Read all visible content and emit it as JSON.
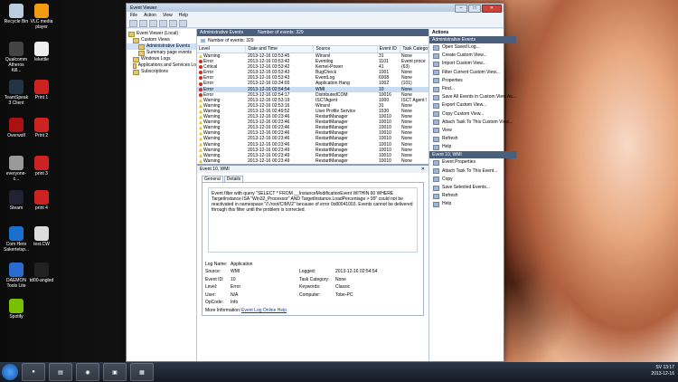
{
  "desktop": {
    "icons": [
      {
        "label": "Recycle Bin",
        "color": "#bcd"
      },
      {
        "label": "VLC media player",
        "color": "#f39c12"
      },
      {
        "label": "Qualcomm Atheros Kill...",
        "color": "#444"
      },
      {
        "label": "lekettle",
        "color": "#eee"
      },
      {
        "label": "TeamSpeak 3 Client",
        "color": "#234"
      },
      {
        "label": "Print 1",
        "color": "#c22"
      },
      {
        "label": "Overwolf",
        "color": "#a11"
      },
      {
        "label": "Print 2",
        "color": "#c22"
      },
      {
        "label": "everyone-c...",
        "color": "#999"
      },
      {
        "label": "print 3",
        "color": "#c22"
      },
      {
        "label": "Steam",
        "color": "#223"
      },
      {
        "label": "print 4",
        "color": "#c22"
      },
      {
        "label": "Com Here Sakertetsp...",
        "color": "#1b6fd1"
      },
      {
        "label": "test.CW",
        "color": "#ddd"
      },
      {
        "label": "DAEMON Tools Lite",
        "color": "#2a6bd0"
      },
      {
        "label": "td00-angled",
        "color": "#222"
      },
      {
        "label": "Spotify",
        "color": "#79c000"
      }
    ]
  },
  "window": {
    "title": "Event Viewer",
    "menu": [
      "File",
      "Action",
      "View",
      "Help"
    ],
    "tree": [
      "Event Viewer (Local)",
      "Custom Views",
      "Administrative Events",
      "Summary page events",
      "Windows Logs",
      "Applications and Services Lo",
      "Subscriptions"
    ]
  },
  "center": {
    "header": "Administrative Events",
    "header_count": "Number of events: 329",
    "count_label": "Number of events: 329",
    "columns": [
      "Level",
      "Date and Time",
      "Source",
      "Event ID",
      "Task Catego"
    ],
    "rows": [
      {
        "level": "Warning",
        "icon": "warning",
        "date": "2013-12-16 03:53:45",
        "source": "Winsrvl",
        "id": "31",
        "task": "None"
      },
      {
        "level": "Error",
        "icon": "error",
        "date": "2013-12-16 03:53:42",
        "source": "Eventlog",
        "id": "1101",
        "task": "Event proce"
      },
      {
        "level": "Critical",
        "icon": "critical",
        "date": "2013-12-16 03:53:42",
        "source": "Kernel-Power",
        "id": "41",
        "task": "(63)"
      },
      {
        "level": "Error",
        "icon": "error",
        "date": "2013-12-16 03:53:43",
        "source": "BugCheck",
        "id": "1001",
        "task": "None"
      },
      {
        "level": "Error",
        "icon": "error",
        "date": "2013-12-16 03:53:43",
        "source": "EventLog",
        "id": "6008",
        "task": "None"
      },
      {
        "level": "Error",
        "icon": "error",
        "date": "2013-12-16 03:34:03",
        "source": "Application Hang",
        "id": "1002",
        "task": "(101)"
      },
      {
        "level": "Error",
        "icon": "error",
        "date": "2013-12-16 02:54:54",
        "source": "WMI",
        "id": "10",
        "task": "None"
      },
      {
        "level": "Error",
        "icon": "error",
        "date": "2013-12-16 02:54:17",
        "source": "DistributedCOM",
        "id": "10016",
        "task": "None"
      },
      {
        "level": "Warning",
        "icon": "warning",
        "date": "2013-12-16 02:53:19",
        "source": "ISCTAgent",
        "id": "1000",
        "task": "ISCT Agent S"
      },
      {
        "level": "Warning",
        "icon": "warning",
        "date": "2013-12-16 02:53:16",
        "source": "Winsrvl",
        "id": "31",
        "task": "None"
      },
      {
        "level": "Warning",
        "icon": "warning",
        "date": "2013-12-16 02:49:52",
        "source": "User Profile Service",
        "id": "1530",
        "task": "None"
      },
      {
        "level": "Warning",
        "icon": "warning",
        "date": "2013-12-16 00:23:46",
        "source": "RestartManager",
        "id": "10010",
        "task": "None"
      },
      {
        "level": "Warning",
        "icon": "warning",
        "date": "2013-12-16 00:23:46",
        "source": "RestartManager",
        "id": "10010",
        "task": "None"
      },
      {
        "level": "Warning",
        "icon": "warning",
        "date": "2013-12-16 00:23:46",
        "source": "RestartManager",
        "id": "10010",
        "task": "None"
      },
      {
        "level": "Warning",
        "icon": "warning",
        "date": "2013-12-16 00:23:46",
        "source": "RestartManager",
        "id": "10010",
        "task": "None"
      },
      {
        "level": "Warning",
        "icon": "warning",
        "date": "2013-12-16 00:23:46",
        "source": "RestartManager",
        "id": "10010",
        "task": "None"
      },
      {
        "level": "Warning",
        "icon": "warning",
        "date": "2013-12-16 00:23:46",
        "source": "RestartManager",
        "id": "10010",
        "task": "None"
      },
      {
        "level": "Warning",
        "icon": "warning",
        "date": "2013-12-16 00:23:49",
        "source": "RestartManager",
        "id": "10010",
        "task": "None"
      },
      {
        "level": "Warning",
        "icon": "warning",
        "date": "2013-12-16 00:23:49",
        "source": "RestartManager",
        "id": "10010",
        "task": "None"
      },
      {
        "level": "Warning",
        "icon": "warning",
        "date": "2013-12-16 00:23:49",
        "source": "RestartManager",
        "id": "10010",
        "task": "None"
      }
    ],
    "detail_title": "Event 10, WMI",
    "tabs": [
      "General",
      "Details"
    ],
    "message": "Event filter with query \"SELECT * FROM __InstanceModificationEvent WITHIN 60 WHERE TargetInstance ISA \"Win32_Processor\" AND TargetInstance.LoadPercentage > 99\" could not be reactivated in namespace \"//./root/CIMV2\" because of error 0x80041003. Events cannot be delivered through this filter until the problem is corrected.",
    "props": [
      {
        "l": "Log Name:",
        "v": "Application",
        "l2": "",
        "v2": ""
      },
      {
        "l": "Source:",
        "v": "WMI",
        "l2": "Logged:",
        "v2": "2013-12-16 02:54:54"
      },
      {
        "l": "Event ID:",
        "v": "10",
        "l2": "Task Category:",
        "v2": "None"
      },
      {
        "l": "Level:",
        "v": "Error",
        "l2": "Keywords:",
        "v2": "Classic"
      },
      {
        "l": "User:",
        "v": "N/A",
        "l2": "Computer:",
        "v2": "Tobe-PC"
      },
      {
        "l": "OpCode:",
        "v": "Info",
        "l2": "",
        "v2": ""
      }
    ],
    "more_info_label": "More Information:",
    "more_info_link": "Event Log Online Help"
  },
  "actions": {
    "title": "Actions",
    "section1": "Administrative Events",
    "items1": [
      "Open Saved Log...",
      "Create Custom View...",
      "Import Custom View...",
      "Filter Current Custom View...",
      "Properties",
      "Find...",
      "Save All Events in Custom View As...",
      "Export Custom View...",
      "Copy Custom View...",
      "Attach Task To This Custom View...",
      "View",
      "Refresh",
      "Help"
    ],
    "section2": "Event 10, WMI",
    "items2": [
      "Event Properties",
      "Attach Task To This Event...",
      "Copy",
      "Save Selected Events...",
      "Refresh",
      "Help"
    ]
  },
  "taskbar": {
    "lang": "SV",
    "time": "13:17",
    "date": "2013-12-16"
  }
}
